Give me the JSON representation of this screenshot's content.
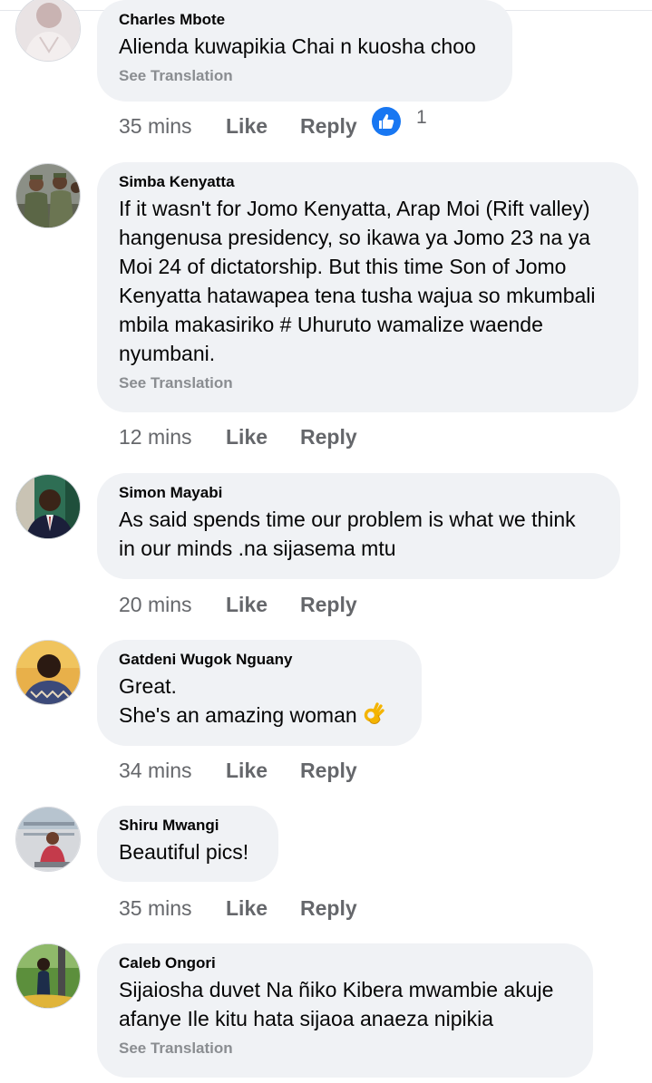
{
  "comments": [
    {
      "author": "Charles Mbote",
      "lines": [
        "Alienda kuwapikia Chai n kuosha choo"
      ],
      "see_translation": "See Translation",
      "time": "35 mins",
      "like_label": "Like",
      "reply_label": "Reply",
      "reaction_icon": "thumbs-up-icon",
      "reaction_count": "1"
    },
    {
      "author": "Simba Kenyatta",
      "lines": [
        "If it wasn't for Jomo Kenyatta, Arap Moi (Rift valley)",
        "hangenusa presidency, so ikawa ya Jomo 23 na ya",
        "Moi 24 of dictatorship. But this time Son of Jomo",
        "Kenyatta hatawapea tena tusha wajua so mkumbali",
        "mbila makasiriko # Uhuruto wamalize waende",
        "nyumbani."
      ],
      "see_translation": "See Translation",
      "time": "12 mins",
      "like_label": "Like",
      "reply_label": "Reply"
    },
    {
      "author": "Simon Mayabi",
      "lines": [
        "As said spends time our problem is what we think",
        "in our minds .na sijasema mtu"
      ],
      "time": "20 mins",
      "like_label": "Like",
      "reply_label": "Reply"
    },
    {
      "author": "Gatdeni Wugok Nguany",
      "lines": [
        "Great.",
        "She's an amazing woman"
      ],
      "emoji": "ok-hand-emoji",
      "time": "34 mins",
      "like_label": "Like",
      "reply_label": "Reply"
    },
    {
      "author": "Shiru Mwangi",
      "lines": [
        "Beautiful pics!"
      ],
      "time": "35 mins",
      "like_label": "Like",
      "reply_label": "Reply"
    },
    {
      "author": "Caleb Ongori",
      "lines": [
        "Sijaiosha duvet Na ñiko Kibera mwambie akuje",
        "afanye Ile kitu hata sijaoa anaeza nipikia"
      ],
      "see_translation": "See Translation",
      "time": "",
      "like_label": "",
      "reply_label": ""
    }
  ],
  "colors": {
    "bubble": "#f0f2f5",
    "secondary_text": "#65676b",
    "translate_text": "#8a8d91",
    "like_blue": "#1877f2"
  }
}
